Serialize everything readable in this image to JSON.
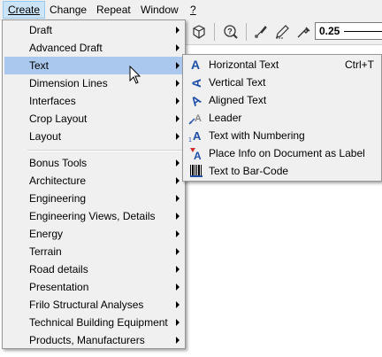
{
  "menubar": {
    "items": [
      {
        "label": "Create",
        "active": true
      },
      {
        "label": "Change"
      },
      {
        "label": "Repeat"
      },
      {
        "label": "Window"
      },
      {
        "label": "?"
      }
    ]
  },
  "toolbar": {
    "icons": [
      "3d-view-icon",
      "help-query-icon",
      "brush-icon",
      "pencil-icon",
      "eyedropper-icon"
    ],
    "line_weight_value": "0.25"
  },
  "create_menu": {
    "group1": [
      {
        "label": "Draft",
        "submenu": true
      },
      {
        "label": "Advanced Draft",
        "submenu": true
      },
      {
        "label": "Text",
        "submenu": true,
        "highlighted": true
      },
      {
        "label": "Dimension Lines",
        "submenu": true
      },
      {
        "label": "Interfaces",
        "submenu": true
      },
      {
        "label": "Crop Layout",
        "submenu": true
      },
      {
        "label": "Layout",
        "submenu": true
      }
    ],
    "group2": [
      {
        "label": "Bonus Tools",
        "submenu": true
      },
      {
        "label": "Architecture",
        "submenu": true
      },
      {
        "label": "Engineering",
        "submenu": true
      },
      {
        "label": "Engineering Views, Details",
        "submenu": true
      },
      {
        "label": "Energy",
        "submenu": true
      },
      {
        "label": "Terrain",
        "submenu": true
      },
      {
        "label": "Road details",
        "submenu": true
      },
      {
        "label": "Presentation",
        "submenu": true
      },
      {
        "label": "Frilo Structural Analyses",
        "submenu": true
      },
      {
        "label": "Technical Building Equipment",
        "submenu": true
      },
      {
        "label": "Products, Manufacturers",
        "submenu": true
      }
    ]
  },
  "text_submenu": {
    "items": [
      {
        "label": "Horizontal Text",
        "shortcut": "Ctrl+T",
        "icon": "horizontal-text-icon"
      },
      {
        "label": "Vertical Text",
        "shortcut": "",
        "icon": "vertical-text-icon"
      },
      {
        "label": "Aligned Text",
        "shortcut": "",
        "icon": "aligned-text-icon"
      },
      {
        "label": "Leader",
        "shortcut": "",
        "icon": "leader-icon"
      },
      {
        "label": "Text with Numbering",
        "shortcut": "",
        "icon": "text-numbering-icon"
      },
      {
        "label": "Place Info on Document as Label",
        "shortcut": "",
        "icon": "place-info-label-icon"
      },
      {
        "label": "Text to Bar-Code",
        "shortcut": "",
        "icon": "barcode-icon"
      }
    ]
  },
  "colors": {
    "menu_bg": "#f0f0f0",
    "highlight": "#aac8ee",
    "active_menubar": "#cce4f7",
    "icon_blue": "#1f4fa8"
  }
}
